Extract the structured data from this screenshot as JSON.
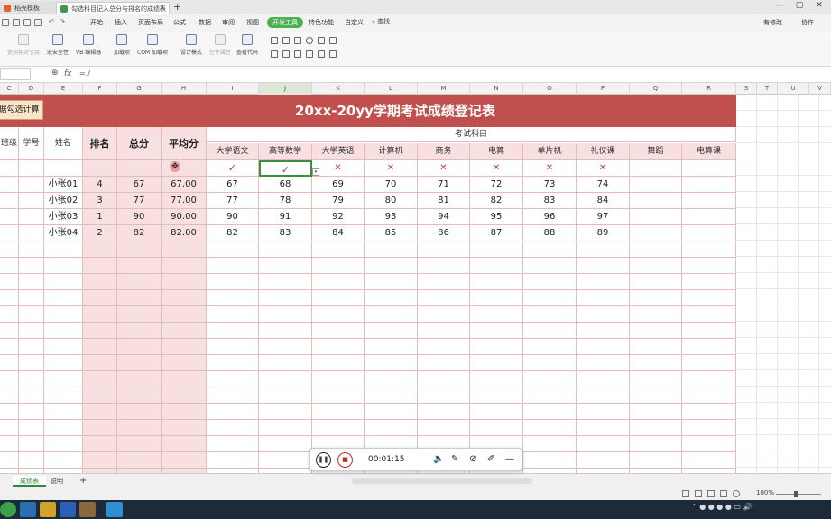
{
  "titlebar": {
    "tabs": [
      {
        "label": "稻壳模板"
      },
      {
        "label": "勾选科目记入总分与排名的成绩表"
      }
    ],
    "new_tab": "+"
  },
  "menubar": {
    "items": [
      "开始",
      "插入",
      "页面布局",
      "公式",
      "数据",
      "审阅",
      "视图",
      "开发工具",
      "特色功能",
      "自定义"
    ],
    "search": "查找",
    "right": [
      "有修改",
      "协作"
    ]
  },
  "ribbon": {
    "buttons": [
      "使用相对引用",
      "宏安全性",
      "VB 编辑器",
      "加载项",
      "COM 加载项",
      "设计模式",
      "控件属性",
      "查看代码"
    ]
  },
  "formula": {
    "text": "=./"
  },
  "columns": [
    "C",
    "D",
    "E",
    "F",
    "G",
    "H",
    "I",
    "J",
    "K",
    "L",
    "M",
    "N",
    "O",
    "P",
    "Q",
    "R",
    "S",
    "T",
    "U",
    "V"
  ],
  "sheet": {
    "title": "20xx-20yy学期考试成绩登记表",
    "calc_button": "据勾选计算",
    "group_header": "考试科目",
    "headers": [
      "班级",
      "学号",
      "姓名",
      "排名",
      "总分",
      "平均分"
    ],
    "subjects": [
      "大学语文",
      "高等数学",
      "大学英语",
      "计算机",
      "商务",
      "电算",
      "单片机",
      "礼仪课",
      "舞蹈",
      "电算课"
    ],
    "marks": [
      "✓",
      "✓",
      "✕",
      "✕",
      "✕",
      "✕",
      "✕",
      "✕",
      "",
      ""
    ],
    "rows": [
      {
        "name": "小张01",
        "rank": "4",
        "total": "67",
        "avg": "67.00",
        "scores": [
          "67",
          "68",
          "69",
          "70",
          "71",
          "72",
          "73",
          "74",
          "",
          ""
        ]
      },
      {
        "name": "小张02",
        "rank": "3",
        "total": "77",
        "avg": "77.00",
        "scores": [
          "77",
          "78",
          "79",
          "80",
          "81",
          "82",
          "83",
          "84",
          "",
          ""
        ]
      },
      {
        "name": "小张03",
        "rank": "1",
        "total": "90",
        "avg": "90.00",
        "scores": [
          "90",
          "91",
          "92",
          "93",
          "94",
          "95",
          "96",
          "97",
          "",
          ""
        ]
      },
      {
        "name": "小张04",
        "rank": "2",
        "total": "82",
        "avg": "82.00",
        "scores": [
          "82",
          "83",
          "84",
          "85",
          "86",
          "87",
          "88",
          "89",
          "",
          ""
        ]
      }
    ]
  },
  "sheettabs": [
    "成绩表",
    "说明"
  ],
  "status": {
    "zoom": "100%"
  },
  "recorder": {
    "time": "00:01:15"
  }
}
